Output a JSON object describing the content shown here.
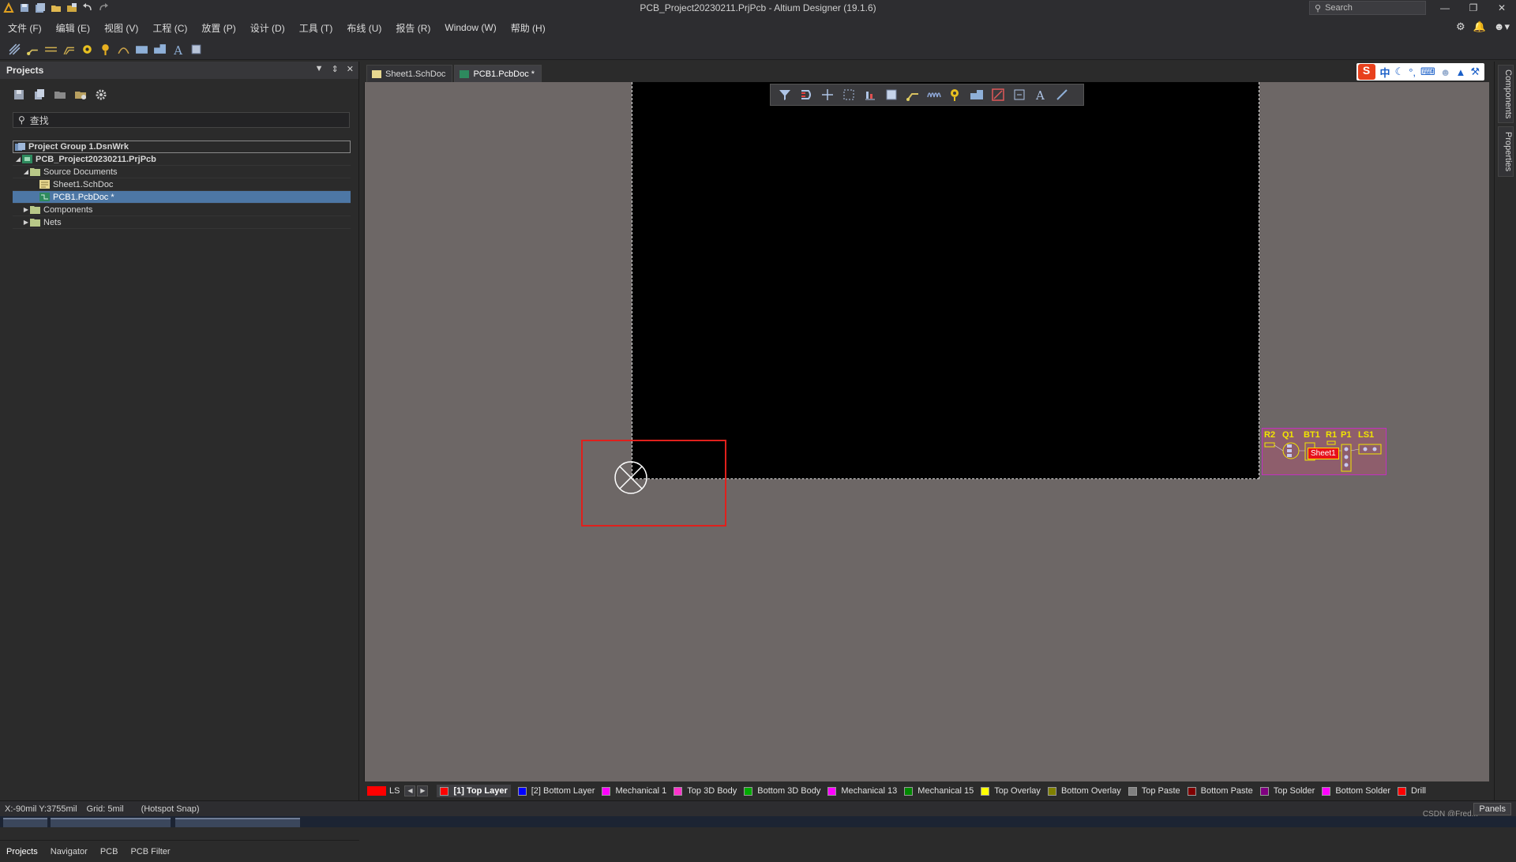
{
  "window": {
    "title": "PCB_Project20230211.PrjPcb - Altium Designer (19.1.6)",
    "search_placeholder": "Search"
  },
  "menu": [
    "文件 (F)",
    "编辑 (E)",
    "视图 (V)",
    "工程 (C)",
    "放置 (P)",
    "设计 (D)",
    "工具 (T)",
    "布线 (U)",
    "报告 (R)",
    "Window (W)",
    "帮助 (H)"
  ],
  "projects_panel": {
    "title": "Projects",
    "find_placeholder": "查找",
    "tree": [
      {
        "label": "Project Group 1.DsnWrk",
        "level": 0,
        "icon": "workspace-icon"
      },
      {
        "label": "PCB_Project20230211.PrjPcb",
        "level": 1,
        "icon": "pcb-project-icon"
      },
      {
        "label": "Source Documents",
        "level": 2,
        "icon": "folder-icon"
      },
      {
        "label": "Sheet1.SchDoc",
        "level": 3,
        "icon": "schematic-doc-icon"
      },
      {
        "label": "PCB1.PcbDoc *",
        "level": 3,
        "icon": "pcb-doc-icon"
      },
      {
        "label": "Components",
        "level": 2,
        "icon": "folder-icon"
      },
      {
        "label": "Nets",
        "level": 2,
        "icon": "folder-icon"
      }
    ],
    "bottom_tabs": [
      "Projects",
      "Navigator",
      "PCB",
      "PCB Filter"
    ]
  },
  "doc_tabs": [
    {
      "label": "Sheet1.SchDoc",
      "active": false
    },
    {
      "label": "PCB1.PcbDoc *",
      "active": true
    }
  ],
  "ime": {
    "logo": "S",
    "lang": "中"
  },
  "canvas": {
    "component_refs": [
      "R2",
      "Q1",
      "BT1",
      "R1",
      "P1",
      "LS1"
    ],
    "room_label": "Sheet1"
  },
  "right_tabs": [
    "Components",
    "Properties"
  ],
  "layer_bar": {
    "ls_label": "LS",
    "layers": [
      {
        "name": "[1] Top Layer",
        "color": "#ff0000",
        "active": true
      },
      {
        "name": "[2] Bottom Layer",
        "color": "#0000ff",
        "active": false
      },
      {
        "name": "Mechanical 1",
        "color": "#ff00ff",
        "active": false
      },
      {
        "name": "Top 3D Body",
        "color": "#ff33cc",
        "active": false
      },
      {
        "name": "Bottom 3D Body",
        "color": "#00aa00",
        "active": false
      },
      {
        "name": "Mechanical 13",
        "color": "#ff00ff",
        "active": false
      },
      {
        "name": "Mechanical 15",
        "color": "#008800",
        "active": false
      },
      {
        "name": "Top Overlay",
        "color": "#ffff00",
        "active": false
      },
      {
        "name": "Bottom Overlay",
        "color": "#808000",
        "active": false
      },
      {
        "name": "Top Paste",
        "color": "#808080",
        "active": false
      },
      {
        "name": "Bottom Paste",
        "color": "#800000",
        "active": false
      },
      {
        "name": "Top Solder",
        "color": "#800080",
        "active": false
      },
      {
        "name": "Bottom Solder",
        "color": "#ff00ff",
        "active": false
      },
      {
        "name": "Drill",
        "color": "#ff0000",
        "active": false
      }
    ]
  },
  "status": {
    "coords": "X:-90mil Y:3755mil",
    "grid": "Grid: 5mil",
    "snap": "(Hotspot Snap)",
    "panels_label": "Panels",
    "watermark": "CSDN @Fred..."
  }
}
